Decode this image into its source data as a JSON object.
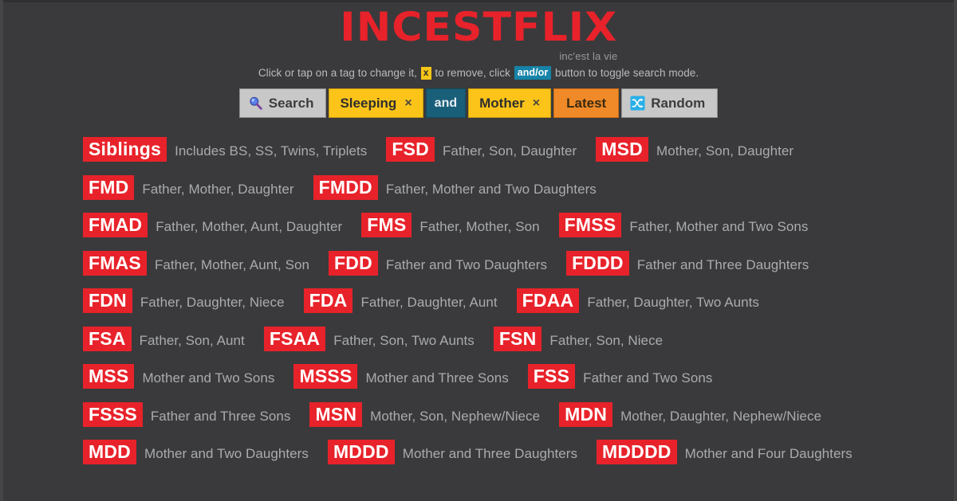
{
  "site": {
    "logo_text": "INCESTFLIX",
    "tagline": "inc'est la vie",
    "logo_color": "#e8222a",
    "background_color": "#3a3a3c"
  },
  "instructions": {
    "part1": "Click or tap on a tag to change it,",
    "x_badge": "x",
    "part2": "to remove, click",
    "andor_badge": "and/or",
    "part3": "button to toggle search mode."
  },
  "searchbar": {
    "search_label": "Search",
    "search_icon": "magnifying-glass-icon",
    "tag1_label": "Sleeping",
    "tag1_remove": "×",
    "operator_label": "and",
    "tag2_label": "Mother",
    "tag2_remove": "×",
    "latest_label": "Latest",
    "random_label": "Random",
    "random_icon": "shuffle-icon",
    "colors": {
      "tag": "#fcc419",
      "operator": "#1a5f7a",
      "latest": "#f08a28",
      "button": "#c8c8c8"
    }
  },
  "tag_rows": [
    [
      {
        "tag": "Siblings",
        "desc": "Includes BS, SS, Twins, Triplets"
      },
      {
        "tag": "FSD",
        "desc": "Father, Son, Daughter"
      },
      {
        "tag": "MSD",
        "desc": "Mother, Son, Daughter"
      }
    ],
    [
      {
        "tag": "FMD",
        "desc": "Father, Mother, Daughter"
      },
      {
        "tag": "FMDD",
        "desc": "Father, Mother and Two Daughters"
      }
    ],
    [
      {
        "tag": "FMAD",
        "desc": "Father, Mother, Aunt, Daughter"
      },
      {
        "tag": "FMS",
        "desc": "Father, Mother, Son"
      },
      {
        "tag": "FMSS",
        "desc": "Father, Mother and Two Sons"
      }
    ],
    [
      {
        "tag": "FMAS",
        "desc": "Father, Mother, Aunt, Son"
      },
      {
        "tag": "FDD",
        "desc": "Father and Two Daughters"
      },
      {
        "tag": "FDDD",
        "desc": "Father and Three Daughters"
      }
    ],
    [
      {
        "tag": "FDN",
        "desc": "Father, Daughter, Niece"
      },
      {
        "tag": "FDA",
        "desc": "Father, Daughter, Aunt"
      },
      {
        "tag": "FDAA",
        "desc": "Father, Daughter, Two Aunts"
      }
    ],
    [
      {
        "tag": "FSA",
        "desc": "Father, Son, Aunt"
      },
      {
        "tag": "FSAA",
        "desc": "Father, Son, Two Aunts"
      },
      {
        "tag": "FSN",
        "desc": "Father, Son, Niece"
      }
    ],
    [
      {
        "tag": "MSS",
        "desc": "Mother and Two Sons"
      },
      {
        "tag": "MSSS",
        "desc": "Mother and Three Sons"
      },
      {
        "tag": "FSS",
        "desc": "Father and Two Sons"
      }
    ],
    [
      {
        "tag": "FSSS",
        "desc": "Father and Three Sons"
      },
      {
        "tag": "MSN",
        "desc": "Mother, Son, Nephew/Niece"
      },
      {
        "tag": "MDN",
        "desc": "Mother, Daughter, Nephew/Niece"
      }
    ],
    [
      {
        "tag": "MDD",
        "desc": "Mother and Two Daughters"
      },
      {
        "tag": "MDDD",
        "desc": "Mother and Three Daughters"
      },
      {
        "tag": "MDDDD",
        "desc": "Mother and Four Daughters"
      }
    ]
  ]
}
